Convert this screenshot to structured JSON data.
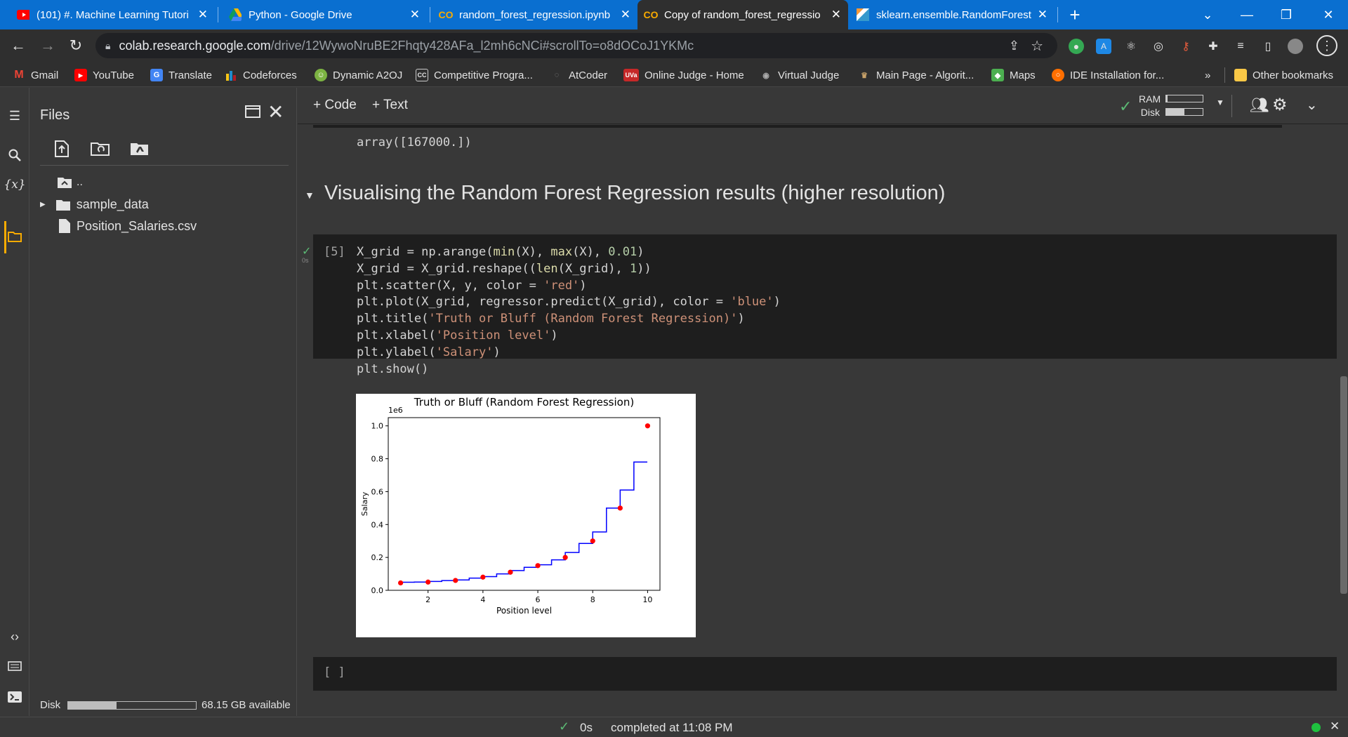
{
  "browser": {
    "tabs": [
      {
        "title": "(101) #. Machine Learning Tutori",
        "icon": "youtube-icon",
        "color": "#ff0000"
      },
      {
        "title": "Python - Google Drive",
        "icon": "google-drive-icon",
        "color": "#34a853"
      },
      {
        "title": "random_forest_regression.ipynb",
        "icon": "colab-icon",
        "color": "#f9ab00"
      },
      {
        "title": "Copy of random_forest_regressio",
        "icon": "colab-icon",
        "color": "#f9ab00"
      },
      {
        "title": "sklearn.ensemble.RandomForestI",
        "icon": "sklearn-icon",
        "color": "#3499cd"
      }
    ],
    "address": {
      "host": "colab.research.google.com",
      "path": "/drive/12WywoNruBE2Fhqty428AFa_l2mh6cNCi#scrollTo=o8dOCoJ1YKMc"
    },
    "bookmarks": [
      {
        "label": "Gmail",
        "icon": "gmail-icon"
      },
      {
        "label": "YouTube",
        "icon": "youtube-icon"
      },
      {
        "label": "Translate",
        "icon": "translate-icon"
      },
      {
        "label": "Codeforces",
        "icon": "codeforces-icon"
      },
      {
        "label": "Dynamic A2OJ",
        "icon": "a2oj-icon"
      },
      {
        "label": "Competitive Progra...",
        "icon": "cp-icon"
      },
      {
        "label": "AtCoder",
        "icon": "atcoder-icon"
      },
      {
        "label": "Online Judge - Home",
        "icon": "uva-icon"
      },
      {
        "label": "Virtual Judge",
        "icon": "vjudge-icon"
      },
      {
        "label": "Main Page - Algorit...",
        "icon": "algorithmist-icon"
      },
      {
        "label": "Maps",
        "icon": "maps-icon"
      },
      {
        "label": "IDE Installation for...",
        "icon": "ide-icon"
      }
    ],
    "overflow": "»",
    "other_bookmarks": "Other bookmarks"
  },
  "colab": {
    "files_title": "Files",
    "tree": [
      {
        "label": "..",
        "type": "parent"
      },
      {
        "label": "sample_data",
        "type": "folder"
      },
      {
        "label": "Position_Salaries.csv",
        "type": "file"
      }
    ],
    "disk_label": "Disk",
    "disk_available": "68.15 GB available",
    "disk_used_fraction": 0.38,
    "code_btn": "Code",
    "text_btn": "Text",
    "ram_label": "RAM",
    "disk_meter_label": "Disk",
    "ram_fraction": 0.04,
    "disk_fraction": 0.5,
    "prev_output": "array([167000.])",
    "section_title": "Visualising the Random Forest Regression results (higher resolution)",
    "cell_index": "[5]",
    "cell_time": "0s",
    "cell_lines": [
      "X_grid = np.arange(min(X), max(X), 0.01)",
      "X_grid = X_grid.reshape((len(X_grid), 1))",
      "plt.scatter(X, y, color = 'red')",
      "plt.plot(X_grid, regressor.predict(X_grid), color = 'blue')",
      "plt.title('Truth or Bluff (Random Forest Regression)')",
      "plt.xlabel('Position level')",
      "plt.ylabel('Salary')",
      "plt.show()"
    ],
    "empty_cell": "[ ]",
    "status_time": "0s",
    "status_text": "completed at 11:08 PM"
  },
  "chart_data": {
    "type": "scatter",
    "title": "Truth or Bluff (Random Forest Regression)",
    "xlabel": "Position level",
    "ylabel": "Salary",
    "offset_text": "1e6",
    "xlim": [
      0.55,
      10.45
    ],
    "ylim": [
      0,
      1.05
    ],
    "xticks": [
      "2",
      "4",
      "6",
      "8",
      "10"
    ],
    "xtick_values": [
      2,
      4,
      6,
      8,
      10
    ],
    "yticks": [
      "0.0",
      "0.2",
      "0.4",
      "0.6",
      "0.8",
      "1.0"
    ],
    "ytick_values": [
      0,
      0.2,
      0.4,
      0.6,
      0.8,
      1.0
    ],
    "grid": false,
    "series": [
      {
        "kind": "scatter",
        "color": "#ff0000",
        "x": [
          1,
          2,
          3,
          4,
          5,
          6,
          7,
          8,
          9,
          10
        ],
        "y": [
          0.045,
          0.05,
          0.06,
          0.08,
          0.11,
          0.15,
          0.2,
          0.3,
          0.5,
          1.0
        ]
      },
      {
        "kind": "step",
        "color": "#0000ff",
        "x": [
          1,
          1.5,
          2,
          2.5,
          3,
          3.5,
          4,
          4.5,
          5,
          5.5,
          6,
          6.5,
          7,
          7.5,
          8,
          8.5,
          9,
          9.5,
          9.99
        ],
        "y": [
          0.049,
          0.05,
          0.054,
          0.059,
          0.063,
          0.074,
          0.083,
          0.1,
          0.12,
          0.14,
          0.155,
          0.185,
          0.23,
          0.285,
          0.355,
          0.5,
          0.61,
          0.78,
          0.78
        ]
      }
    ]
  }
}
